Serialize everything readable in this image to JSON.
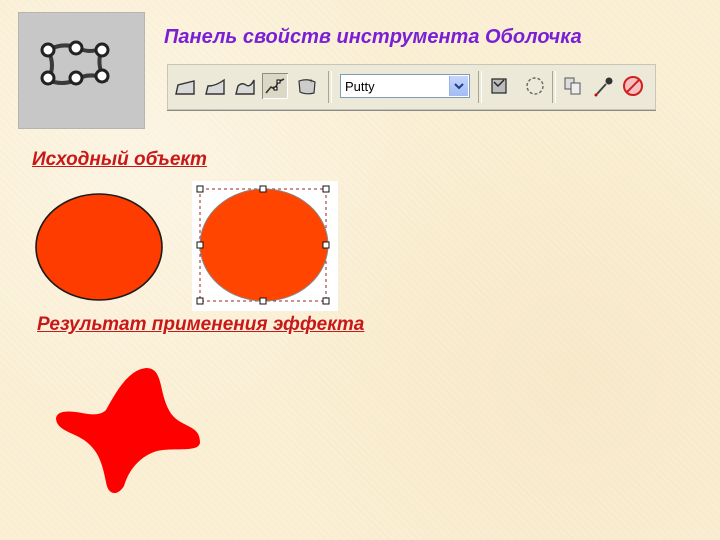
{
  "title": "Панель свойств инструмента Оболочка",
  "toolbar": {
    "preset_value": "Putty",
    "icons": [
      "envelope-straight-line-mode-icon",
      "envelope-single-arc-mode-icon",
      "envelope-double-arc-mode-icon",
      "envelope-unconstrained-mode-icon",
      "add-new-envelope-icon",
      "preset-dropdown-icon",
      "create-envelope-from-icon",
      "mapping-mode-icon",
      "copy-envelope-properties-icon",
      "eyedropper-icon",
      "clear-envelope-icon"
    ]
  },
  "labels": {
    "source_object": "Исходный объект",
    "result": "Результат применения эффекта"
  },
  "colors": {
    "title": "#7a1fd6",
    "heading": "#c81818",
    "ellipse_fill": "#ff3c00",
    "selected_fill": "#ff4500",
    "result_fill": "#ff0000",
    "background": "#fbf0d6"
  }
}
